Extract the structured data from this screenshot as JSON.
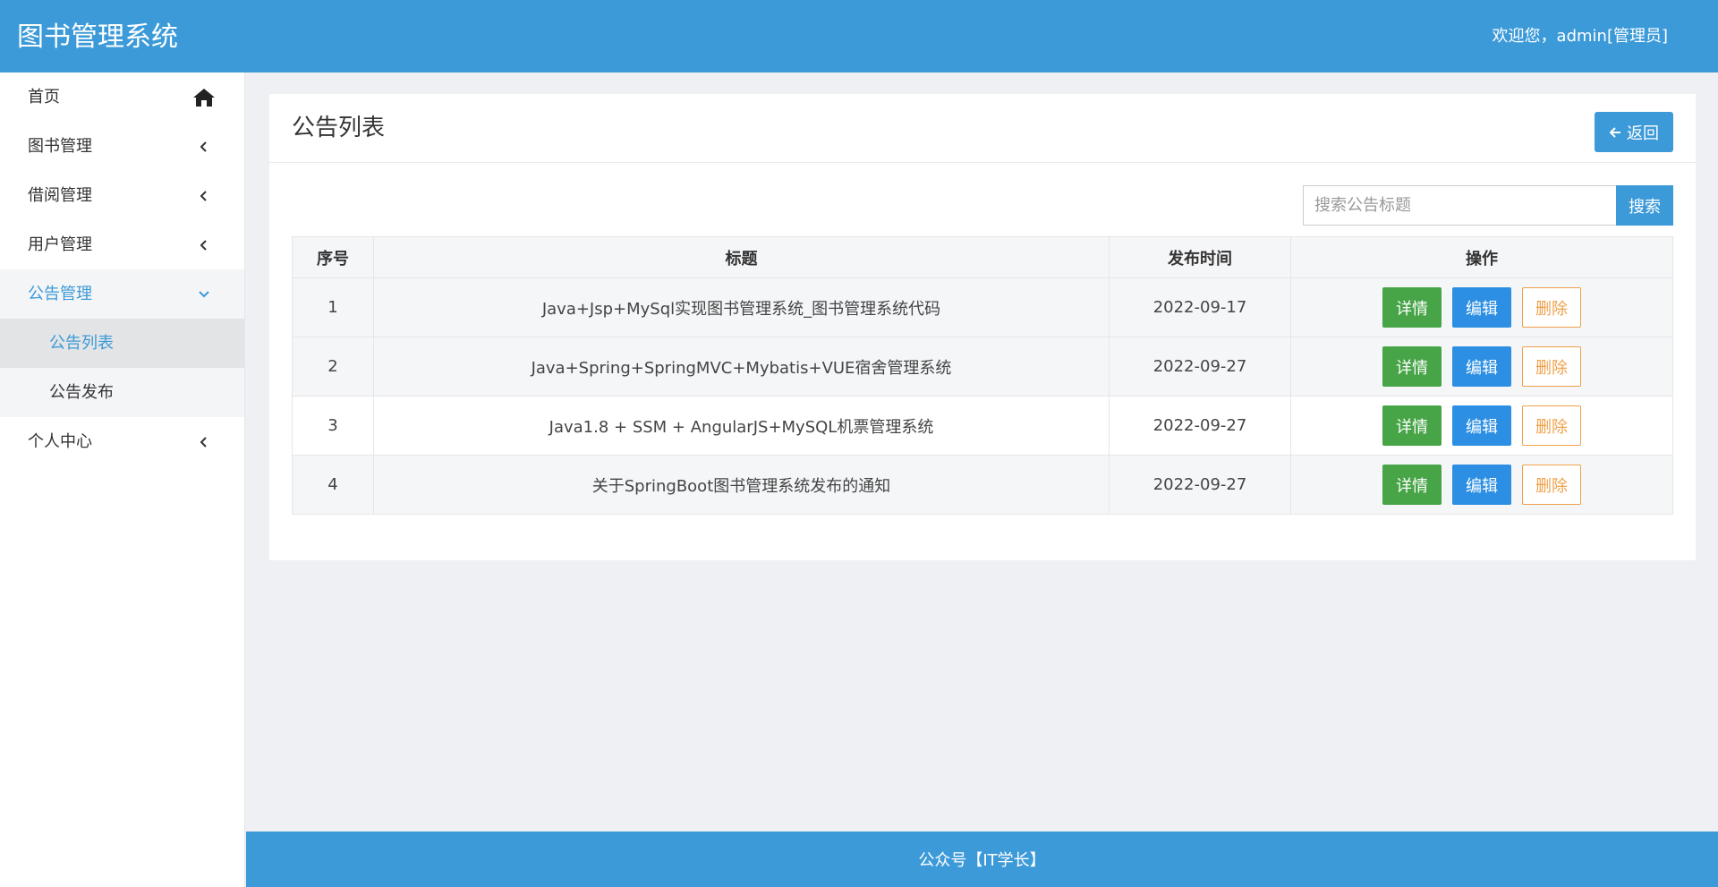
{
  "header": {
    "brand": "图书管理系统",
    "welcome": "欢迎您，admin[管理员]"
  },
  "sidebar": {
    "items": [
      {
        "label": "首页",
        "icon": "home-icon"
      },
      {
        "label": "图书管理",
        "icon": "chevron-left-icon"
      },
      {
        "label": "借阅管理",
        "icon": "chevron-left-icon"
      },
      {
        "label": "用户管理",
        "icon": "chevron-left-icon"
      },
      {
        "label": "公告管理",
        "icon": "chevron-down-icon",
        "active": true,
        "children": [
          {
            "label": "公告列表",
            "active": true
          },
          {
            "label": "公告发布"
          }
        ]
      },
      {
        "label": "个人中心",
        "icon": "chevron-left-icon"
      }
    ]
  },
  "panel": {
    "title": "公告列表",
    "back_label": "返回"
  },
  "search": {
    "placeholder": "搜索公告标题",
    "button_label": "搜索"
  },
  "table": {
    "headers": [
      "序号",
      "标题",
      "发布时间",
      "操作"
    ],
    "rows": [
      {
        "no": "1",
        "title": "Java+Jsp+MySql实现图书管理系统_图书管理系统代码",
        "date": "2022-09-17"
      },
      {
        "no": "2",
        "title": "Java+Spring+SpringMVC+Mybatis+VUE宿舍管理系统",
        "date": "2022-09-27"
      },
      {
        "no": "3",
        "title": "Java1.8 + SSM + AngularJS+MySQL机票管理系统",
        "date": "2022-09-27"
      },
      {
        "no": "4",
        "title": "关于SpringBoot图书管理系统发布的通知",
        "date": "2022-09-27"
      }
    ],
    "actions": {
      "detail": "详情",
      "edit": "编辑",
      "delete": "删除"
    }
  },
  "footer": {
    "text": "公众号【IT学长】"
  },
  "colors": {
    "primary": "#3c9ad9",
    "success": "#47a447",
    "edit": "#2d8fe3",
    "warning": "#f0a048"
  }
}
